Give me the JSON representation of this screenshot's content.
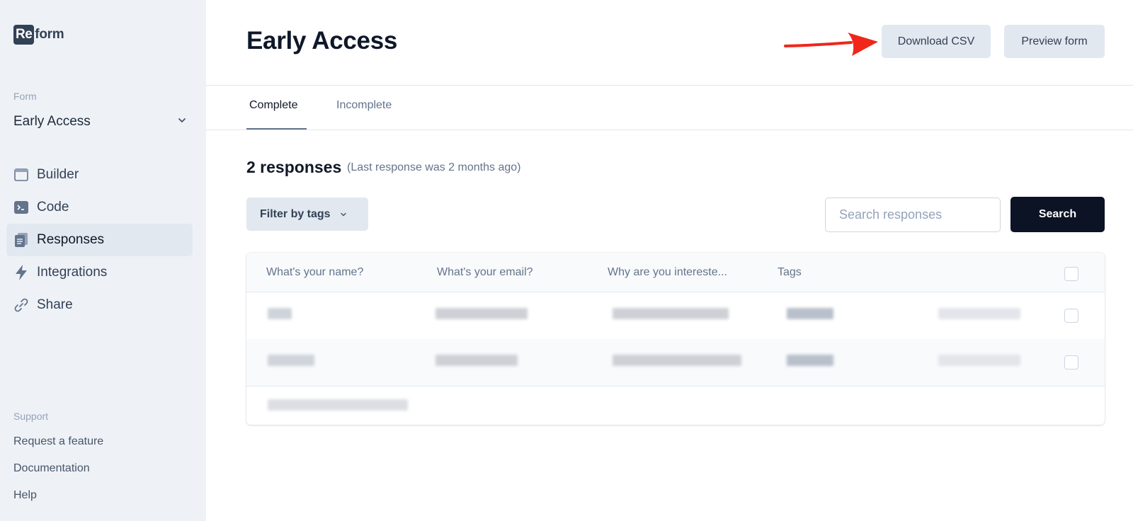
{
  "sidebar": {
    "logo_box": "Re",
    "logo_rest": "form",
    "form_label": "Form",
    "form_name": "Early Access",
    "nav": [
      {
        "label": "Builder",
        "icon": "browser-window-icon"
      },
      {
        "label": "Code",
        "icon": "terminal-icon"
      },
      {
        "label": "Responses",
        "icon": "clipboard-icon",
        "active": true
      },
      {
        "label": "Integrations",
        "icon": "lightning-icon"
      },
      {
        "label": "Share",
        "icon": "link-icon"
      }
    ],
    "support_label": "Support",
    "support_links": [
      "Request a feature",
      "Documentation",
      "Help"
    ]
  },
  "header": {
    "title": "Early Access",
    "download_csv": "Download CSV",
    "preview_form": "Preview form",
    "annotation": "red-arrow pointing at Download CSV"
  },
  "tabs": [
    {
      "label": "Complete",
      "active": true
    },
    {
      "label": "Incomplete",
      "active": false
    }
  ],
  "responses": {
    "count_text": "2 responses",
    "subtitle": "(Last response was 2 months ago)"
  },
  "toolbar": {
    "filter_label": "Filter by tags",
    "search_placeholder": "Search responses",
    "search_value": "",
    "search_button": "Search"
  },
  "table": {
    "columns": [
      "What's your name?",
      "What's your email?",
      "Why are you intereste...",
      "Tags"
    ],
    "rows_note": "cell contents pixelated / redacted",
    "row_count": 2
  },
  "colors": {
    "sidebar_bg": "#eef2f7",
    "primary_dark": "#0b1324",
    "button_gray": "#e2e8f0",
    "annotation_red": "#f0261b"
  }
}
